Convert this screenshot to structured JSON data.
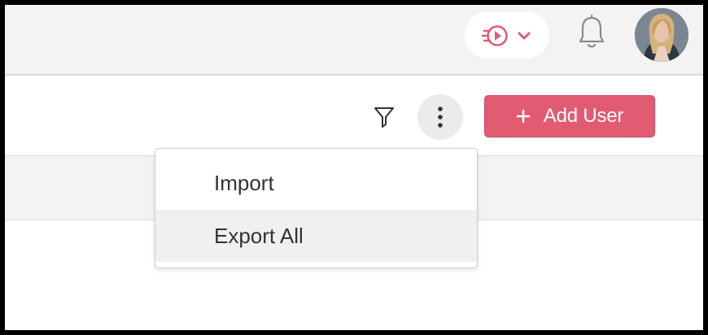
{
  "header": {
    "dashboard_icon": "play-dashboard-icon",
    "dropdown_icon": "chevron-down-icon",
    "notification_icon": "bell-icon",
    "avatar_label": "User avatar",
    "accent_color": "#e15b73"
  },
  "toolbar": {
    "filter_icon": "filter-icon",
    "more_icon": "more-vertical-icon",
    "add_user_label": "Add User"
  },
  "menu": {
    "items": [
      {
        "label": "Import"
      },
      {
        "label": "Export All"
      }
    ]
  }
}
